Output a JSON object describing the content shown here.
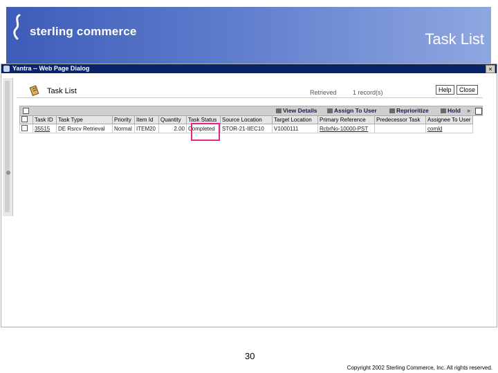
{
  "header": {
    "brand": "sterling commerce",
    "slide_title": "Task List"
  },
  "dialog": {
    "window_title": "Yantra -- Web Page Dialog",
    "close_glyph": "×"
  },
  "task_list": {
    "heading": "Task List",
    "retrieved_label": "Retrieved",
    "retrieved_count": "1 record(s)",
    "help_label": "Help",
    "close_label": "Close"
  },
  "actions": {
    "view_details": "View Details",
    "assign_to_user": "Assign To User",
    "reprioritize": "Reprioritize",
    "hold": "Hold",
    "more": "»"
  },
  "table": {
    "columns": [
      "",
      "Task ID",
      "Task Type",
      "Priority",
      "Item Id",
      "Quantity",
      "Task Status",
      "Source Location",
      "Target Location",
      "Primary Reference",
      "Predecessor Task",
      "Assignee To User"
    ],
    "rows": [
      [
        "",
        "35515",
        "DE Rsrcv Retrieval",
        "Normal",
        "ITEM20",
        "2.00",
        "Completed",
        "STOR-21-IIEC10",
        "V1000111",
        "RcbrNo-10000-PST",
        "",
        "comld"
      ]
    ]
  },
  "footer": {
    "page_number": "30",
    "copyright": "Copyright 2002 Sterling Commerce, Inc. All rights reserved."
  },
  "colors": {
    "banner": "#3e5cb8",
    "highlight": "#e0248a",
    "title_bar": "#0a246a"
  }
}
